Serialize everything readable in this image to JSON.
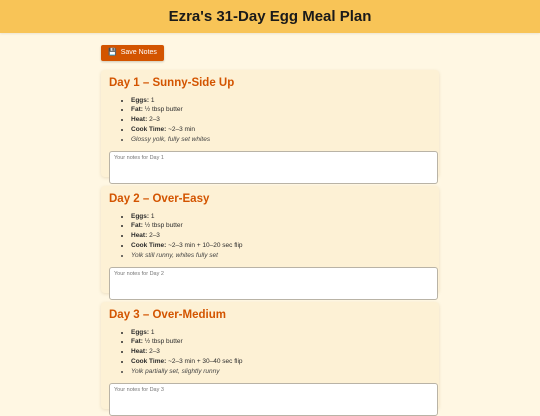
{
  "header": {
    "title": "Ezra's 31-Day Egg Meal Plan"
  },
  "toolbar": {
    "save_icon": "💾",
    "save_label": "Save Notes"
  },
  "days": [
    {
      "title": "Day 1 – Sunny-Side Up",
      "eggs_label": "Eggs:",
      "eggs": "1",
      "fat_label": "Fat:",
      "fat": "½ tbsp butter",
      "heat_label": "Heat:",
      "heat": "2–3",
      "cook_label": "Cook Time:",
      "cook": "~2–3 min",
      "note": "Glossy yolk, fully set whites",
      "placeholder": "Your notes for Day 1"
    },
    {
      "title": "Day 2 – Over-Easy",
      "eggs_label": "Eggs:",
      "eggs": "1",
      "fat_label": "Fat:",
      "fat": "½ tbsp butter",
      "heat_label": "Heat:",
      "heat": "2–3",
      "cook_label": "Cook Time:",
      "cook": "~2–3 min + 10–20 sec flip",
      "note": "Yolk still runny, whites fully set",
      "placeholder": "Your notes for Day 2"
    },
    {
      "title": "Day 3 – Over-Medium",
      "eggs_label": "Eggs:",
      "eggs": "1",
      "fat_label": "Fat:",
      "fat": "½ tbsp butter",
      "heat_label": "Heat:",
      "heat": "2–3",
      "cook_label": "Cook Time:",
      "cook": "~2–3 min + 30–40 sec flip",
      "note": "Yolk partially set, slightly runny",
      "placeholder": "Your notes for Day 3"
    }
  ]
}
